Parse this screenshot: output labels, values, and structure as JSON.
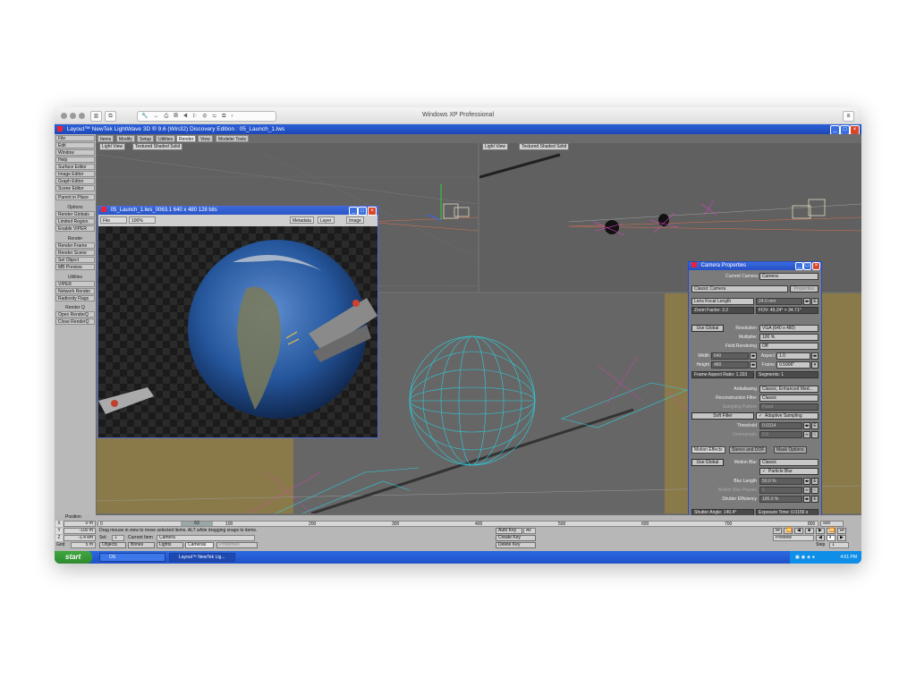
{
  "mac": {
    "title": "Windows XP Professional"
  },
  "lw": {
    "title": "Layout™ NewTek LightWave 3D ® 9.6 (Win32) Discovery Edition : 05_Launch_1.lws",
    "menu": [
      {
        "id": "file",
        "label": "File"
      },
      {
        "id": "edit",
        "label": "Edit"
      },
      {
        "id": "window",
        "label": "Window"
      },
      {
        "id": "help",
        "label": "Help"
      }
    ],
    "editors": [
      "Surface Editor",
      "Image Editor",
      "Graph Editor",
      "Scene Editor"
    ],
    "parent_btn": "Parent in Place",
    "groups": [
      {
        "header": "Options",
        "items": [
          "Render Globals",
          "Limited Region",
          "Enable VIPER"
        ]
      },
      {
        "header": "Render",
        "items": [
          "Render Frame",
          "Render Scene",
          "Sel Object",
          "MB Preview"
        ]
      },
      {
        "header": "Utilities",
        "items": [
          "VIPER",
          "Network Render",
          "Radiosity Flags"
        ]
      },
      {
        "header": "Render Q",
        "items": [
          "Open RenderQ",
          "Close RenderQ"
        ]
      }
    ],
    "tabs": [
      "Items",
      "Modify",
      "Setup",
      "Utilities",
      "Render",
      "View",
      "Modeler Tools"
    ],
    "active_tab": "Render",
    "viewport_left": {
      "view": "Light View",
      "shading": "Textured Shaded Solid"
    },
    "viewport_right": {
      "view": "Light View",
      "shading": "Textured Shaded Solid"
    }
  },
  "image_viewer": {
    "title": "05_Launch_1.lws_0063.1  640 x 480 128 bits",
    "file_menu": "File",
    "zoom": "100%",
    "buttons": [
      "Metadata",
      "Layer",
      "Image"
    ]
  },
  "camera": {
    "title": "Camera Properties",
    "current_camera_label": "Current Camera",
    "current_camera": "Camera",
    "camera_type": "Classic Camera",
    "properties_btn": "Properties",
    "lens_focal_label": "Lens Focal Length",
    "lens_focal": "24.0 mm",
    "zoom_factor": "Zoom Factor: 3.2",
    "fov": "FOV: 45.24° × 34.71°",
    "use_global": "Use Global",
    "resolution_label": "Resolution",
    "resolution": "VGA (640 x 480)",
    "multiplier_label": "Multiplier",
    "multiplier": "100 %",
    "field_rendering_label": "Field Rendering",
    "field_rendering": "Off",
    "width_label": "Width",
    "width": "640",
    "aspect_label": "Aspect",
    "aspect": "1.0",
    "height_label": "Height",
    "height": "480",
    "frame_label": "Frame",
    "frame": "0.5906\"",
    "frame_aspect": "Frame Aspect Ratio: 1.333",
    "segments": "Segments: 1",
    "antialiasing_label": "Antialiasing",
    "antialiasing": "Classic, Enhanced Med...",
    "reconstruction_label": "Reconstruction Filter",
    "reconstruction": "Classic",
    "sampling_pattern_label": "Sampling Pattern",
    "sampling_pattern": "Fixed",
    "soft_filter": "Soft Filter",
    "adaptive_sampling": "Adaptive Sampling",
    "threshold_label": "Threshold",
    "threshold": "0.0314",
    "oversample_label": "Oversample",
    "oversample": "0.0",
    "subtabs": [
      "Motion Effects",
      "Stereo and DOF",
      "Mask Options"
    ],
    "motion_blur_label": "Motion Blur",
    "motion_blur": "Classic",
    "particle_blur": "Particle Blur",
    "blur_length_label": "Blur Length",
    "blur_length": "50.0 %",
    "motion_blur_passes_label": "Motion Blur Passes",
    "motion_blur_passes": "1",
    "shutter_eff_label": "Shutter Efficiency",
    "shutter_eff": "100.0 %",
    "shutter_angle": "Shutter Angle: 140.4°",
    "exposure_time": "Exposure Time: 0.0156 s"
  },
  "timeline": {
    "position_label": "Position",
    "axes": [
      {
        "axis": "X",
        "value": "0 m"
      },
      {
        "axis": "Y",
        "value": "-100 m"
      },
      {
        "axis": "Z",
        "value": "-1.4 km"
      }
    ],
    "grid_label": "Grid",
    "grid_value": "5 m",
    "ticks": [
      "0",
      "100",
      "200",
      "300",
      "400",
      "500",
      "600",
      "700",
      "800",
      "900"
    ],
    "current_frame": "63",
    "end_frame": "900",
    "status_msg": "Drag mouse in view to move selected items. ALT while dragging snaps to items.",
    "sel_label": "Sel:",
    "sel_value": "1",
    "current_item_label": "Current Item",
    "current_item": "Camera",
    "filters": [
      "Objects",
      "Bones",
      "Lights",
      "Cameras"
    ],
    "properties": "Properties",
    "auto_key": "Auto Key",
    "auto_key_value": "All",
    "create_key": "Create Key",
    "delete_key": "Delete Key",
    "preview": "Preview",
    "step_label": "Step",
    "step": "1"
  },
  "taskbar": {
    "start": "start",
    "items": [
      "OS",
      "Layout™ NewTek Lig..."
    ],
    "clock": "4:51 PM"
  }
}
